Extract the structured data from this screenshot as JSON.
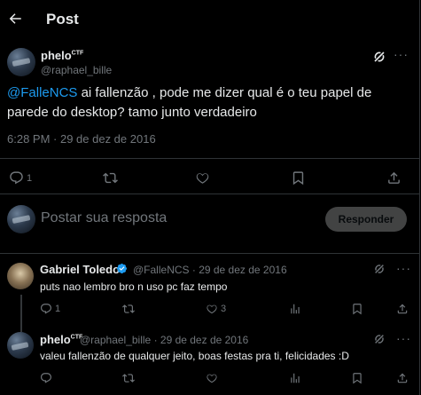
{
  "header": {
    "title": "Post"
  },
  "post": {
    "author_name": "phelo",
    "author_badge": "CTF",
    "author_handle": "@raphael_bille",
    "mention": "@FalleNCS",
    "text": " ai fallenzão , pode me dizer qual é o teu papel de parede do desktop? tamo junto verdadeiro",
    "timestamp": "6:28 PM · 29 de dez de 2016",
    "actions": {
      "replies": "1"
    }
  },
  "compose": {
    "placeholder": "Postar sua resposta",
    "button": "Responder"
  },
  "replies": [
    {
      "name": "Gabriel Toledo",
      "verified": true,
      "handle_date": "@FalleNCS · 29 de dez de 2016",
      "text": "puts nao lembro bro n uso pc faz tempo",
      "actions": {
        "replies": "1",
        "likes": "3"
      }
    },
    {
      "name": "phelo",
      "badge": "CTF",
      "handle_date": "@raphael_bille · 29 de dez de 2016",
      "text": "valeu fallenzão de qualquer jeito, boas festas pra ti, felicidades :D"
    }
  ],
  "colors": {
    "accent": "#1d9bf0",
    "muted": "#71767b",
    "border": "#2f3336",
    "background": "#000000"
  }
}
